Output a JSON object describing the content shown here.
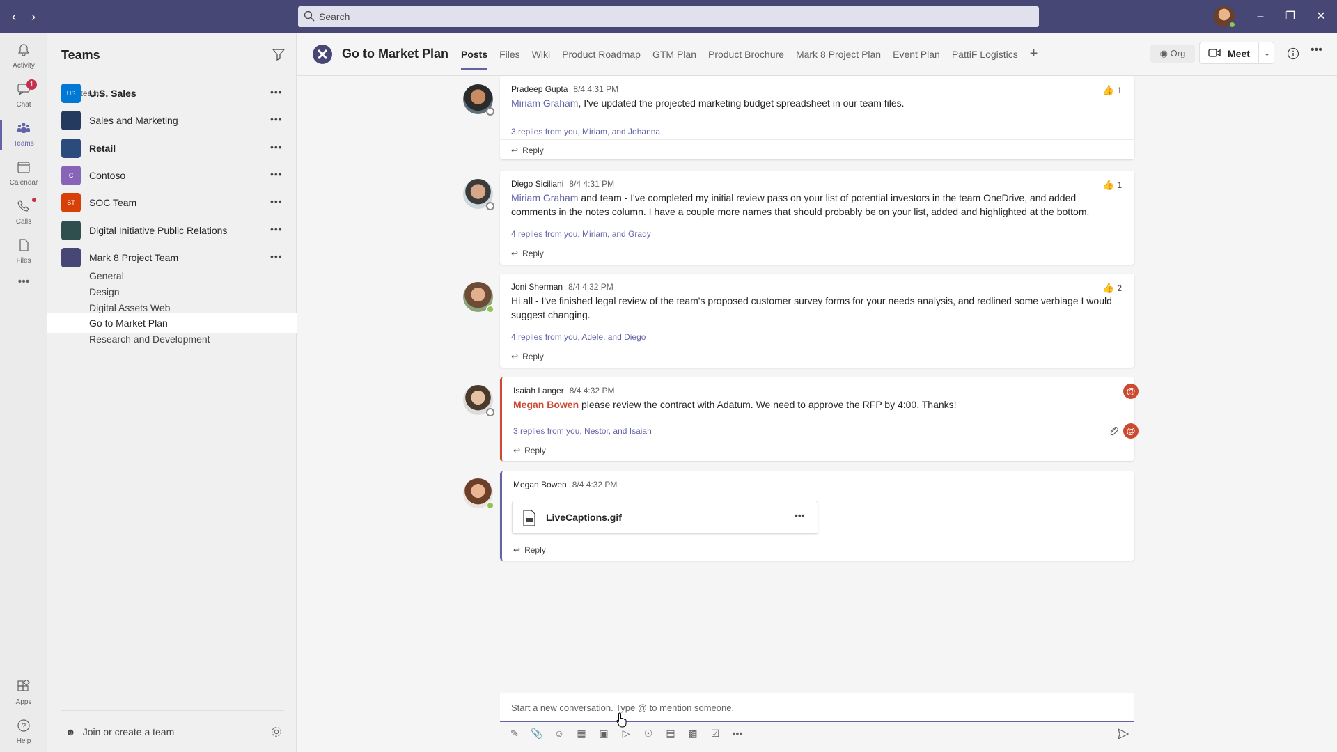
{
  "titlebar": {
    "search_placeholder": "Search"
  },
  "appbar": {
    "items": [
      {
        "label": "Activity"
      },
      {
        "label": "Chat",
        "badge": "1"
      },
      {
        "label": "Teams"
      },
      {
        "label": "Calendar"
      },
      {
        "label": "Calls"
      },
      {
        "label": "Files"
      },
      {
        "label": "Apps"
      },
      {
        "label": "Help"
      }
    ]
  },
  "leftpane": {
    "title": "Teams",
    "section": "Your teams",
    "teams": [
      {
        "name": "U.S. Sales",
        "abbr": "US",
        "color": "#0078d4",
        "bold": true
      },
      {
        "name": "Sales and Marketing",
        "abbr": "",
        "color": "#243a5e",
        "bold": false
      },
      {
        "name": "Retail",
        "abbr": "",
        "color": "#2a4b7c",
        "bold": true
      },
      {
        "name": "Contoso",
        "abbr": "C",
        "color": "#8764b8",
        "bold": false
      },
      {
        "name": "SOC Team",
        "abbr": "ST",
        "color": "#d74108",
        "bold": false
      },
      {
        "name": "Digital Initiative Public Relations",
        "abbr": "",
        "color": "#2f4f4f",
        "bold": false
      },
      {
        "name": "Mark 8 Project Team",
        "abbr": "",
        "color": "#464775",
        "bold": false
      }
    ],
    "channels": [
      "General",
      "Design",
      "Digital Assets Web",
      "Go to Market Plan",
      "Research and Development"
    ],
    "join_label": "Join or create a team"
  },
  "header": {
    "channel_name": "Go to Market Plan",
    "tabs": [
      "Posts",
      "Files",
      "Wiki",
      "Product Roadmap",
      "GTM Plan",
      "Product Brochure",
      "Mark 8 Project Plan",
      "Event Plan",
      "PattiF Logistics"
    ],
    "org_label": "Org",
    "meet_label": "Meet"
  },
  "messages": [
    {
      "author": "Pradeep Gupta",
      "time": "8/4 4:31 PM",
      "mention": "Miriam Graham",
      "text": ", I've updated the projected marketing budget spreadsheet in our team files.",
      "replies": "3 replies from you, Miriam, and Johanna",
      "reply_label": "Reply",
      "likes": "1"
    },
    {
      "author": "Diego Siciliani",
      "time": "8/4 4:31 PM",
      "mention": "Miriam Graham",
      "text": " and team - I've completed my initial review pass on your list of potential investors in the team OneDrive, and added comments in the notes column. I have a couple more names that should probably be on your list, added and highlighted at the bottom.",
      "replies": "4 replies from you, Miriam, and Grady",
      "reply_label": "Reply",
      "likes": "1"
    },
    {
      "author": "Joni Sherman",
      "time": "8/4 4:32 PM",
      "text": "Hi all - I've finished legal review of the team's proposed customer survey forms for your needs analysis, and redlined some verbiage I would suggest changing.",
      "replies": "4 replies from you, Adele, and Diego",
      "reply_label": "Reply",
      "likes": "2"
    },
    {
      "author": "Isaiah Langer",
      "time": "8/4 4:32 PM",
      "mention": "Megan Bowen",
      "text": " please review the contract with Adatum. We need to approve the RFP by 4:00. Thanks!",
      "replies": "3 replies from you, Nestor, and Isaiah",
      "reply_label": "Reply"
    },
    {
      "author": "Megan Bowen",
      "time": "8/4 4:32 PM",
      "file_name": "LiveCaptions.gif",
      "reply_label": "Reply"
    }
  ],
  "compose": {
    "placeholder": "Start a new conversation. Type @ to mention someone."
  },
  "colors": {
    "brand": "#464775",
    "accent": "#6264a7",
    "mention": "#cc4a31",
    "presence_online": "#92c353"
  }
}
